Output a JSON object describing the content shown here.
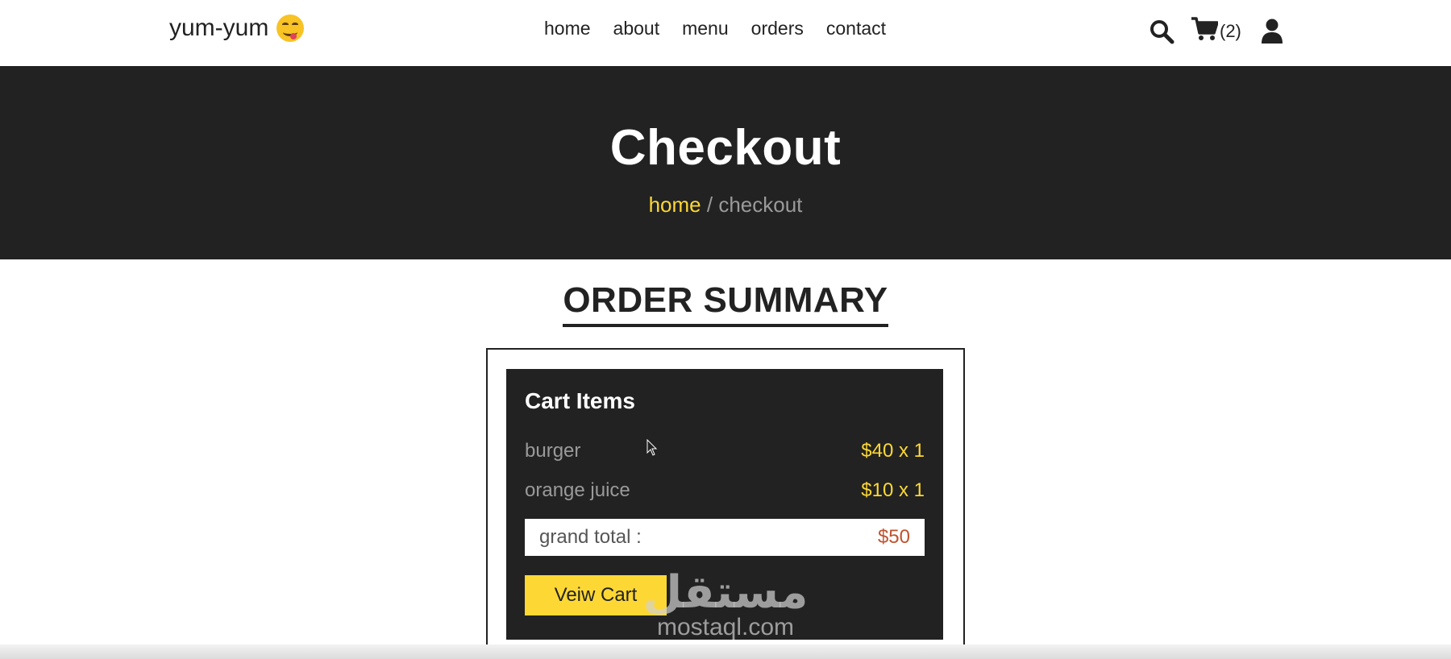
{
  "header": {
    "logo_text": "yum-yum",
    "logo_emoji": "face-savoring-food",
    "nav": [
      "home",
      "about",
      "menu",
      "orders",
      "contact"
    ],
    "cart_count": "(2)"
  },
  "banner": {
    "title": "Checkout",
    "breadcrumb_home": "home",
    "breadcrumb_sep": " / ",
    "breadcrumb_current": "checkout"
  },
  "summary": {
    "title": "ORDER SUMMARY",
    "cart_title": "Cart Items",
    "items": [
      {
        "name": "burger",
        "price": "$40 x 1"
      },
      {
        "name": "orange juice",
        "price": "$10 x 1"
      }
    ],
    "grand_total_label": "grand total :",
    "grand_total_value": "$50",
    "view_cart_label": "Veiw Cart"
  },
  "watermark": {
    "arabic": "مستقل",
    "latin": "mostaql.com"
  },
  "colors": {
    "accent": "#fdd835",
    "dark": "#222222",
    "total_price": "#c0532e"
  }
}
